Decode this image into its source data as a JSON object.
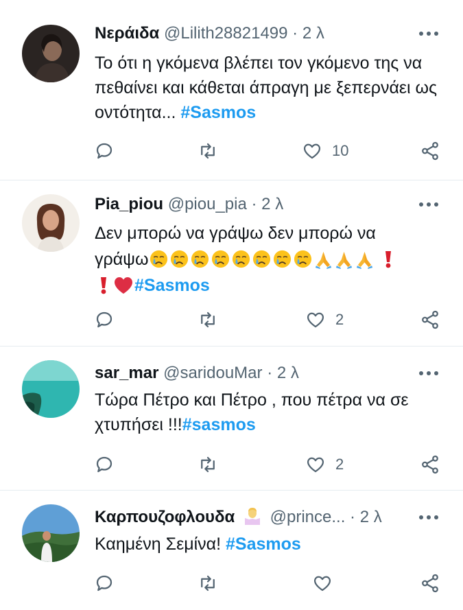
{
  "tweets": [
    {
      "name": "Νεράιδα",
      "handle": "@Lilith28821499",
      "separator": "·",
      "time": "2 λ",
      "text_before": "Το ότι η γκόμενα βλέπει τον γκόμενο της να πεθαίνει και κάθεται άπραγη με ξεπερνάει ως οντότητα... ",
      "hashtag": "#Sasmos",
      "like_count": "10"
    },
    {
      "name": "Pia_piou",
      "handle": "@piou_pia",
      "separator": "·",
      "time": "2 λ",
      "text_line1": "Δεν μπορώ να γράψω δεν μπορώ να",
      "text_line2": "γράψω",
      "hashtag": "#Sasmos",
      "like_count": "2"
    },
    {
      "name": "sar_mar",
      "handle": "@saridouMar",
      "separator": "·",
      "time": "2 λ",
      "text_line1": "Τώρα Πέτρο και Πέτρο , που πέτρα να σε",
      "text_line2": "χτυπήσει !!!",
      "hashtag": "#sasmos",
      "like_count": "2"
    },
    {
      "name": "Καρπουζοφλουδα",
      "handle": "@prince...",
      "separator": "·",
      "time": "2 λ",
      "text_before": "Καημένη Σεμίνα! ",
      "hashtag": "#Sasmos",
      "like_count": ""
    }
  ],
  "icons": {
    "reply": "reply-icon",
    "retweet": "retweet-icon",
    "like": "heart-icon",
    "share": "share-icon",
    "more": "more-icon"
  },
  "colors": {
    "hashtag": "#1d9bf0",
    "secondary_text": "#536471",
    "divider": "#e6ecf0"
  }
}
